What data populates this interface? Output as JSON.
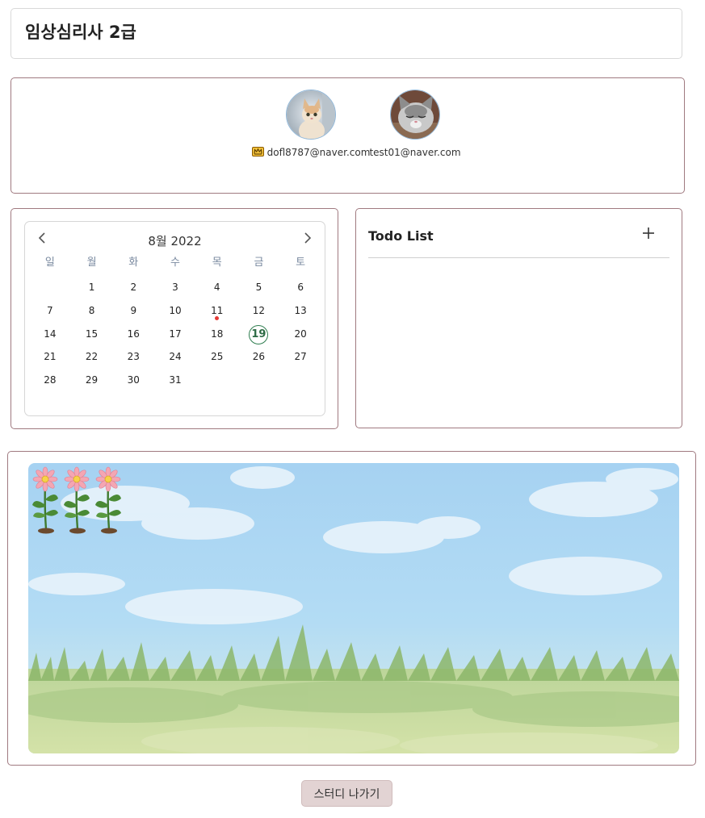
{
  "page": {
    "title": "임상심리사 2급"
  },
  "members": [
    {
      "email": "dofl8787@naver.com",
      "is_leader": true,
      "crown_icon": "crown-icon",
      "avatar": "cat-avatar"
    },
    {
      "email": "test01@naver.com",
      "is_leader": false,
      "avatar": "kitten-avatar"
    }
  ],
  "calendar": {
    "month_label": "8월 2022",
    "prev_icon": "chevron-left-icon",
    "next_icon": "chevron-right-icon",
    "weekdays": [
      "일",
      "월",
      "화",
      "수",
      "목",
      "금",
      "토"
    ],
    "first_weekday_offset": 1,
    "days_in_month": 31,
    "today": 19,
    "event_days": [
      11
    ],
    "today_color": "#2e7d4f",
    "event_dot_color": "#e53935"
  },
  "todo": {
    "title": "Todo List",
    "add_icon": "plus-icon",
    "items": []
  },
  "garden": {
    "flower_count": 3,
    "flower_icon": "flower-icon"
  },
  "actions": {
    "leave_label": "스터디 나가기"
  }
}
